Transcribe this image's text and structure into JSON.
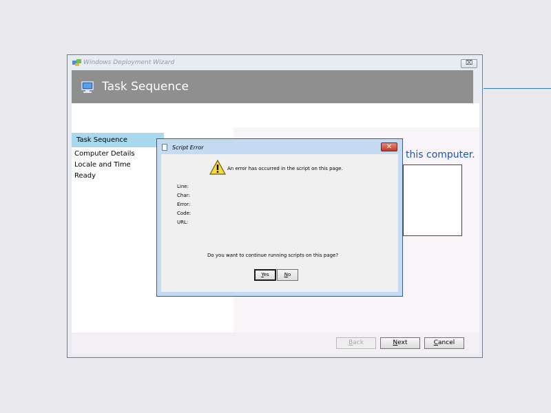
{
  "wizard": {
    "title": "Windows Deployment Wizard",
    "close_label": "⌧",
    "header_title": "Task Sequence",
    "nav_items": [
      "Task Sequence",
      "Computer Details",
      "Locale and Time",
      "Ready"
    ],
    "selected_nav": "Task Sequence",
    "partial_heading": "this computer.",
    "buttons": {
      "back": {
        "underline": "B",
        "rest": "ack"
      },
      "next": {
        "underline": "N",
        "rest": "ext"
      },
      "cancel": {
        "underline": "C",
        "rest": "ancel"
      }
    }
  },
  "dialog": {
    "title": "Script Error",
    "close_label": "✕",
    "message": "An error has occurred in the script on this page.",
    "fields": [
      "Line:",
      "Char:",
      "Error:",
      "Code:",
      "URL:"
    ],
    "question": "Do you want to continue running scripts on this page?",
    "yes": {
      "underline": "Y",
      "rest": "es"
    },
    "no": {
      "underline": "N",
      "rest": "o"
    }
  },
  "colors": {
    "accent_line": "#2e7bbf",
    "header_gray": "#8f8f8f",
    "selected_nav": "#a8d8ee",
    "heading_blue": "#1b56a8",
    "dialog_close": "#c23a24"
  }
}
